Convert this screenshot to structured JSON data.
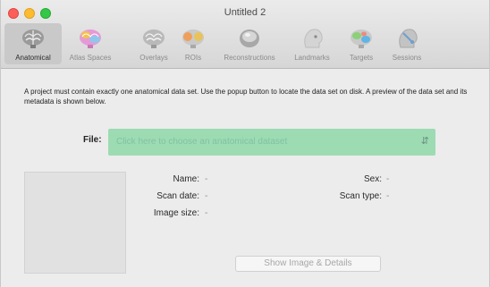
{
  "window": {
    "title": "Untitled 2"
  },
  "toolbar": {
    "items": [
      {
        "label": "Anatomical",
        "icon": "brain-icon",
        "selected": true
      },
      {
        "label": "Atlas Spaces",
        "icon": "atlas-brain-icon",
        "selected": false
      },
      {
        "label": "Overlays",
        "icon": "overlay-brain-icon",
        "selected": false
      },
      {
        "label": "ROIs",
        "icon": "roi-brain-icon",
        "selected": false
      },
      {
        "label": "Reconstructions",
        "icon": "reconstruction-icon",
        "selected": false
      },
      {
        "label": "Landmarks",
        "icon": "landmark-head-icon",
        "selected": false
      },
      {
        "label": "Targets",
        "icon": "target-brain-icon",
        "selected": false
      },
      {
        "label": "Sessions",
        "icon": "session-head-icon",
        "selected": false
      }
    ]
  },
  "content": {
    "description": "A project must contain exactly one anatomical data set. Use the popup button to locate the data set on disk. A preview of the data set and its metadata is shown below.",
    "file_label": "File:",
    "file_placeholder": "Click here to choose an anatomical dataset",
    "meta": {
      "name_label": "Name:",
      "name_value": "-",
      "scan_date_label": "Scan date:",
      "scan_date_value": "-",
      "image_size_label": "Image size:",
      "image_size_value": "-",
      "sex_label": "Sex:",
      "sex_value": "-",
      "scan_type_label": "Scan type:",
      "scan_type_value": "-"
    },
    "show_button": "Show Image & Details"
  },
  "colors": {
    "popup_bg": "#9ddbb3",
    "close": "#fc5f57",
    "minimize": "#fdbc2e",
    "maximize": "#34c748"
  }
}
